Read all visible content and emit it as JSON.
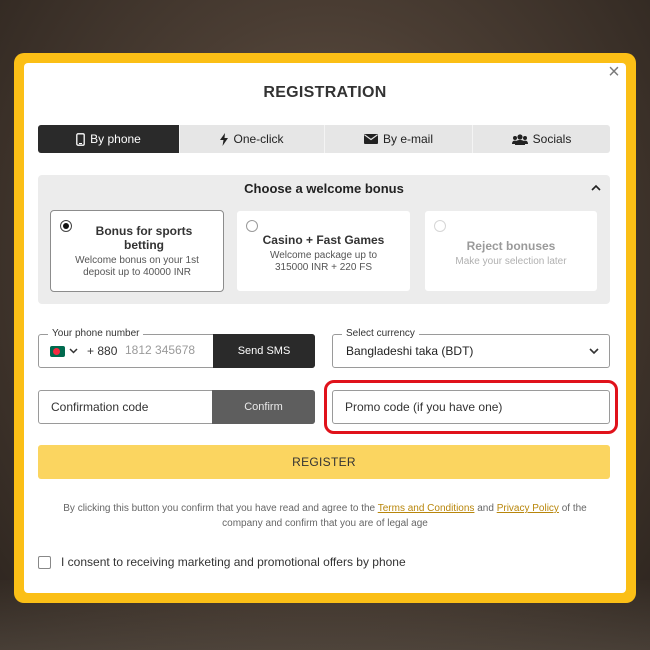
{
  "modal": {
    "title": "REGISTRATION",
    "close_symbol": "×"
  },
  "tabs": [
    {
      "label": "By phone",
      "icon": "phone-icon",
      "active": true
    },
    {
      "label": "One-click",
      "icon": "lightning-icon",
      "active": false
    },
    {
      "label": "By e-mail",
      "icon": "envelope-icon",
      "active": false
    },
    {
      "label": "Socials",
      "icon": "people-icon",
      "active": false
    }
  ],
  "bonus": {
    "heading": "Choose a welcome bonus",
    "options": [
      {
        "title": "Bonus for sports betting",
        "subtitle": "Welcome bonus on your 1st deposit up to 40000 INR",
        "selected": true
      },
      {
        "title": "Casino + Fast Games",
        "subtitle": "Welcome package up to 315000 INR + 220 FS",
        "selected": false
      },
      {
        "title": "Reject bonuses",
        "subtitle": "Make your selection later",
        "selected": false
      }
    ]
  },
  "phone": {
    "label": "Your phone number",
    "country_code": "+ 880",
    "placeholder": "1812 345678",
    "send_sms_label": "Send SMS"
  },
  "currency": {
    "label": "Select currency",
    "value": "Bangladeshi taka (BDT)"
  },
  "confirmation": {
    "placeholder": "Confirmation code",
    "button_label": "Confirm"
  },
  "promo": {
    "placeholder": "Promo code (if you have one)"
  },
  "register_label": "REGISTER",
  "legal": {
    "prefix": "By clicking this button you confirm that you have read and agree to the",
    "terms_link": "Terms and Conditions",
    "and": "and",
    "privacy_link": "Privacy Policy",
    "suffix": "of the company and confirm that you are of legal age"
  },
  "consent_label": "I consent to receiving marketing and promotional offers by phone",
  "colors": {
    "frame": "#fbbf16",
    "register_button": "#fbd560",
    "highlight": "#e0121b",
    "link": "#b8860b"
  }
}
